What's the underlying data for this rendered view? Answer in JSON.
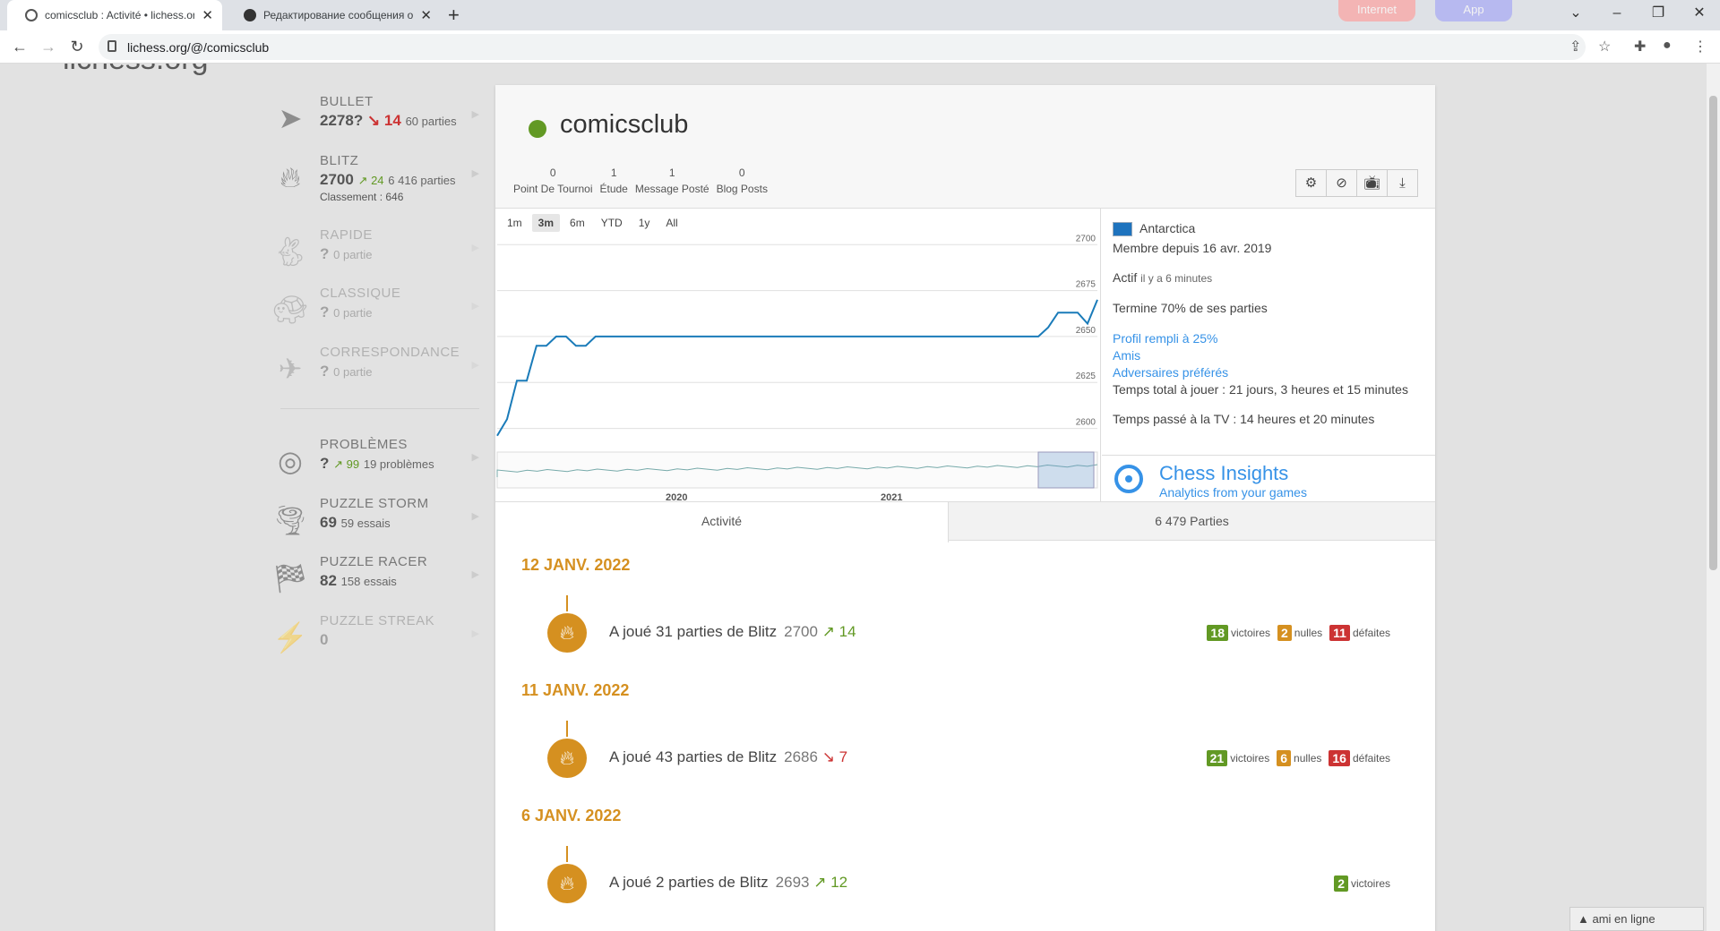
{
  "browser": {
    "tabs": [
      {
        "title": "comicsclub : Activité • lichess.org"
      },
      {
        "title": "Редактирование сообщения от"
      }
    ],
    "pills": [
      "Internet",
      "App"
    ],
    "url": "lichess.org/@/comicsclub"
  },
  "site": {
    "logo": "lichess.org"
  },
  "perfs": [
    {
      "name": "BULLET",
      "rating": "2278?",
      "progress": "14",
      "trend": "down",
      "games": "60 parties",
      "icon": "bullet-icon"
    },
    {
      "name": "BLITZ",
      "rating": "2700",
      "progress": "24",
      "trend": "up",
      "games": "6 416 parties",
      "rank": "Classement : 646",
      "icon": "fire-icon"
    },
    {
      "name": "RAPIDE",
      "rating": "?",
      "games": "0 partie",
      "icon": "rabbit-icon"
    },
    {
      "name": "CLASSIQUE",
      "rating": "?",
      "games": "0 partie",
      "icon": "turtle-icon"
    },
    {
      "name": "CORRESPONDANCE",
      "rating": "?",
      "games": "0 partie",
      "icon": "paper-plane-icon"
    },
    {
      "name": "PROBLÈMES",
      "rating": "?",
      "progress": "99",
      "trend": "up",
      "games": "19 problèmes",
      "icon": "target-icon"
    },
    {
      "name": "PUZZLE STORM",
      "rating": "69",
      "games": "59 essais",
      "icon": "tornado-icon"
    },
    {
      "name": "PUZZLE RACER",
      "rating": "82",
      "games": "158 essais",
      "icon": "checkered-flag-icon"
    },
    {
      "name": "PUZZLE STREAK",
      "rating": "0",
      "icon": "streak-icon"
    }
  ],
  "profile": {
    "username": "comicsclub",
    "counts": [
      {
        "value": "0",
        "label": "Point De Tournoi"
      },
      {
        "value": "1",
        "label": "Étude"
      },
      {
        "value": "1",
        "label": "Message Posté"
      },
      {
        "value": "0",
        "label": "Blog Posts"
      }
    ],
    "location": "Antarctica",
    "member_since": "Membre depuis 16 avr. 2019",
    "active_label": "Actif",
    "active_ago": "il y a 6 minutes",
    "completion": "Termine 70% de ses parties",
    "links": [
      "Profil rempli à 25%",
      "Amis",
      "Adversaires préférés"
    ],
    "play_time": "Temps total à jouer : 21 jours, 3 heures et 15 minutes",
    "tv_time": "Temps passé à la TV : 14 heures et 20 minutes",
    "insights_title": "Chess Insights",
    "insights_sub": "Analytics from your games"
  },
  "chart_data": {
    "type": "line",
    "range_buttons": [
      "1m",
      "3m",
      "6m",
      "YTD",
      "1y",
      "All"
    ],
    "selected_range": "3m",
    "y_ticks": [
      "2700",
      "2675",
      "2650",
      "2625",
      "2600"
    ],
    "ylim": [
      2592,
      2705
    ],
    "navigator_labels": [
      "2020",
      "2021"
    ],
    "series": [
      {
        "values": [
          2596,
          2605,
          2626,
          2626,
          2645,
          2645,
          2650,
          2650,
          2645,
          2645,
          2650,
          2650,
          2650,
          2650,
          2650,
          2650,
          2650,
          2650,
          2650,
          2650,
          2650,
          2650,
          2650,
          2650,
          2650,
          2650,
          2650,
          2650,
          2650,
          2650,
          2650,
          2650,
          2650,
          2650,
          2650,
          2650,
          2650,
          2650,
          2650,
          2650,
          2650,
          2650,
          2650,
          2650,
          2650,
          2650,
          2650,
          2650,
          2650,
          2650,
          2650,
          2650,
          2650,
          2650,
          2650,
          2650,
          2655,
          2663,
          2663,
          2663,
          2657,
          2670
        ]
      }
    ]
  },
  "subtabs": {
    "activity": "Activité",
    "games": "6 479 Parties"
  },
  "activity": [
    {
      "date": "12 JANV. 2022",
      "text": "A joué 31 parties de Blitz",
      "rating": "2700",
      "diff": "14",
      "trend": "up",
      "wins": "18",
      "draws": "2",
      "losses": "11"
    },
    {
      "date": "11 JANV. 2022",
      "text": "A joué 43 parties de Blitz",
      "rating": "2686",
      "diff": "7",
      "trend": "down",
      "wins": "21",
      "draws": "6",
      "losses": "16"
    },
    {
      "date": "6 JANV. 2022",
      "text": "A joué 2 parties de Blitz",
      "rating": "2693",
      "diff": "12",
      "trend": "up",
      "wins": "2"
    }
  ],
  "score_labels": {
    "wins": "victoires",
    "draws": "nulles",
    "losses": "défaites"
  },
  "friends_bar": "ami en ligne"
}
